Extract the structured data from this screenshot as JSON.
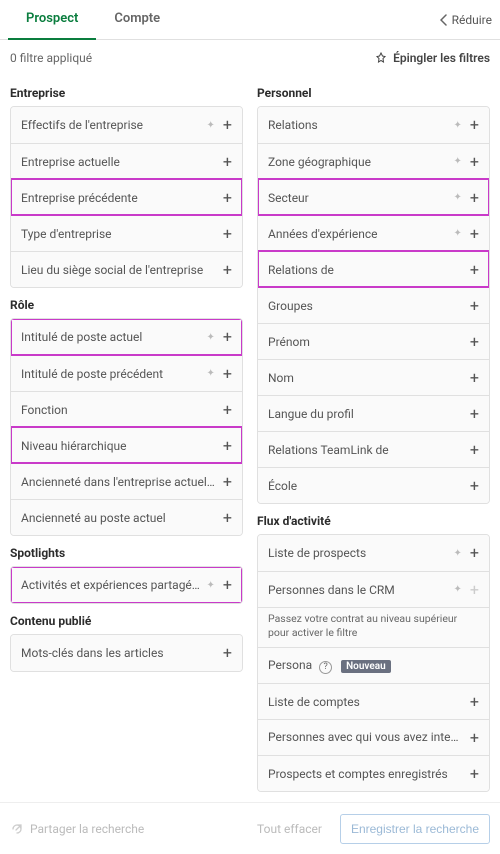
{
  "tabs": {
    "prospect": "Prospect",
    "compte": "Compte"
  },
  "collapse": "Réduire",
  "applied": "0 filtre appliqué",
  "pin_filters": "Épingler les filtres",
  "sections": {
    "entreprise": "Entreprise",
    "role": "Rôle",
    "spotlights": "Spotlights",
    "contenu": "Contenu publié",
    "personnel": "Personnel",
    "flux": "Flux d'activité"
  },
  "company": {
    "size": "Effectifs de l'entreprise",
    "current": "Entreprise actuelle",
    "previous": "Entreprise précédente",
    "type": "Type d'entreprise",
    "hq": "Lieu du siège social de l'entreprise"
  },
  "role": {
    "current_title": "Intitulé de poste actuel",
    "past_title": "Intitulé de poste précédent",
    "function": "Fonction",
    "seniority": "Niveau hiérarchique",
    "tenure_company": "Ancienneté dans l'entreprise actuelle",
    "tenure_role": "Ancienneté au poste actuel"
  },
  "spotlights": {
    "shared": "Activités et expériences partagées"
  },
  "content": {
    "keywords": "Mots-clés dans les articles"
  },
  "personal": {
    "relations": "Relations",
    "geo": "Zone géographique",
    "industry": "Secteur",
    "years_exp": "Années d'expérience",
    "relations_of": "Relations de",
    "groups": "Groupes",
    "firstname": "Prénom",
    "lastname": "Nom",
    "lang": "Langue du profil",
    "teamlink": "Relations TeamLink de",
    "school": "École"
  },
  "activity": {
    "lead_list": "Liste de prospects",
    "crm": "Personnes dans le CRM",
    "crm_note": "Passez votre contrat au niveau supérieur pour activer le filtre",
    "persona": "Persona",
    "persona_badge": "Nouveau",
    "account_list": "Liste de comptes",
    "interacted": "Personnes avec qui vous avez interagi",
    "saved": "Prospects et comptes enregistrés"
  },
  "footer": {
    "share": "Partager la recherche",
    "clear": "Tout effacer",
    "save": "Enregistrer la recherche"
  }
}
